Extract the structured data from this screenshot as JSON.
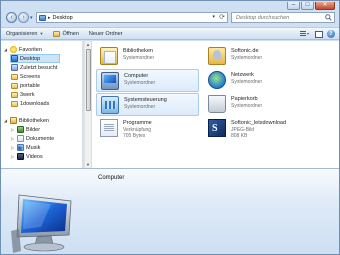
{
  "window": {
    "caption_buttons": {
      "minimize": "–",
      "maximize": "□",
      "close": "✕"
    }
  },
  "addressbar": {
    "location": "Desktop",
    "search_placeholder": "Desktop durchsuchen"
  },
  "toolbar": {
    "organize": "Organisieren",
    "open": "Öffnen",
    "new_folder": "Neuer Ordner"
  },
  "navpane": {
    "favorites_header": "Favoriten",
    "favorites": [
      "Desktop",
      "Zuletzt besucht",
      "Screens",
      "portable",
      "3werk",
      "1downloads"
    ],
    "libraries_header": "Bibliotheken",
    "libraries": [
      "Bilder",
      "Dokumente",
      "Musik",
      "Videos"
    ]
  },
  "items": [
    {
      "name": "Bibliotheken",
      "sub1": "Systemordner",
      "sub2": "",
      "icon": "library-icon"
    },
    {
      "name": "Softonic.de",
      "sub1": "Systemordner",
      "sub2": "",
      "icon": "user-folder-icon"
    },
    {
      "name": "Computer",
      "sub1": "Systemordner",
      "sub2": "",
      "icon": "computer-icon"
    },
    {
      "name": "Netzwerk",
      "sub1": "Systemordner",
      "sub2": "",
      "icon": "network-icon"
    },
    {
      "name": "Systemsteuerung",
      "sub1": "Systemordner",
      "sub2": "",
      "icon": "control-panel-icon"
    },
    {
      "name": "Papierkorb",
      "sub1": "Systemordner",
      "sub2": "",
      "icon": "recycle-bin-icon"
    },
    {
      "name": "Programme",
      "sub1": "Verknüpfung",
      "sub2": "705 Bytes",
      "icon": "shortcut-icon"
    },
    {
      "name": "Softonic_letsdownload",
      "sub1": "JPEG-Bild",
      "sub2": "808 KB",
      "icon": "jpeg-image-icon"
    }
  ],
  "details": {
    "selected_name": "Computer"
  }
}
